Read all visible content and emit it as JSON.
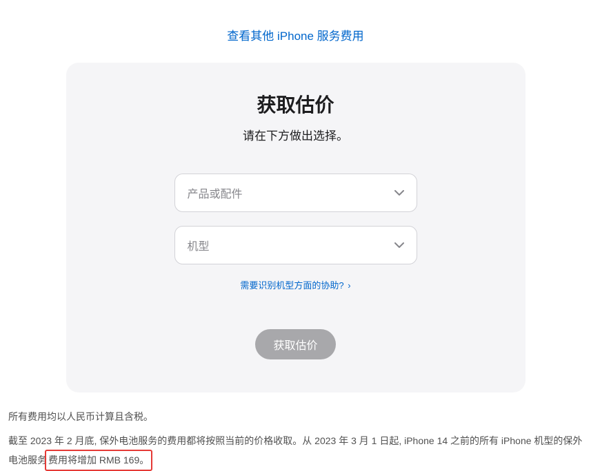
{
  "topLink": {
    "label": "查看其他 iPhone 服务费用"
  },
  "card": {
    "title": "获取估价",
    "subtitle": "请在下方做出选择。",
    "productSelect": {
      "placeholder": "产品或配件"
    },
    "modelSelect": {
      "placeholder": "机型"
    },
    "helpLink": {
      "label": "需要识别机型方面的协助?"
    },
    "submitButton": {
      "label": "获取估价"
    }
  },
  "footer": {
    "line1": "所有费用均以人民币计算且含税。",
    "line2_part1": "截至 2023 年 2 月底, 保外电池服务的费用都将按照当前的价格收取。从 2023 年 3 月 1 日起, iPhone 14 之前的所有 iPhone 机型的保外电池服务",
    "line2_highlight": "费用将增加 RMB 169。"
  }
}
